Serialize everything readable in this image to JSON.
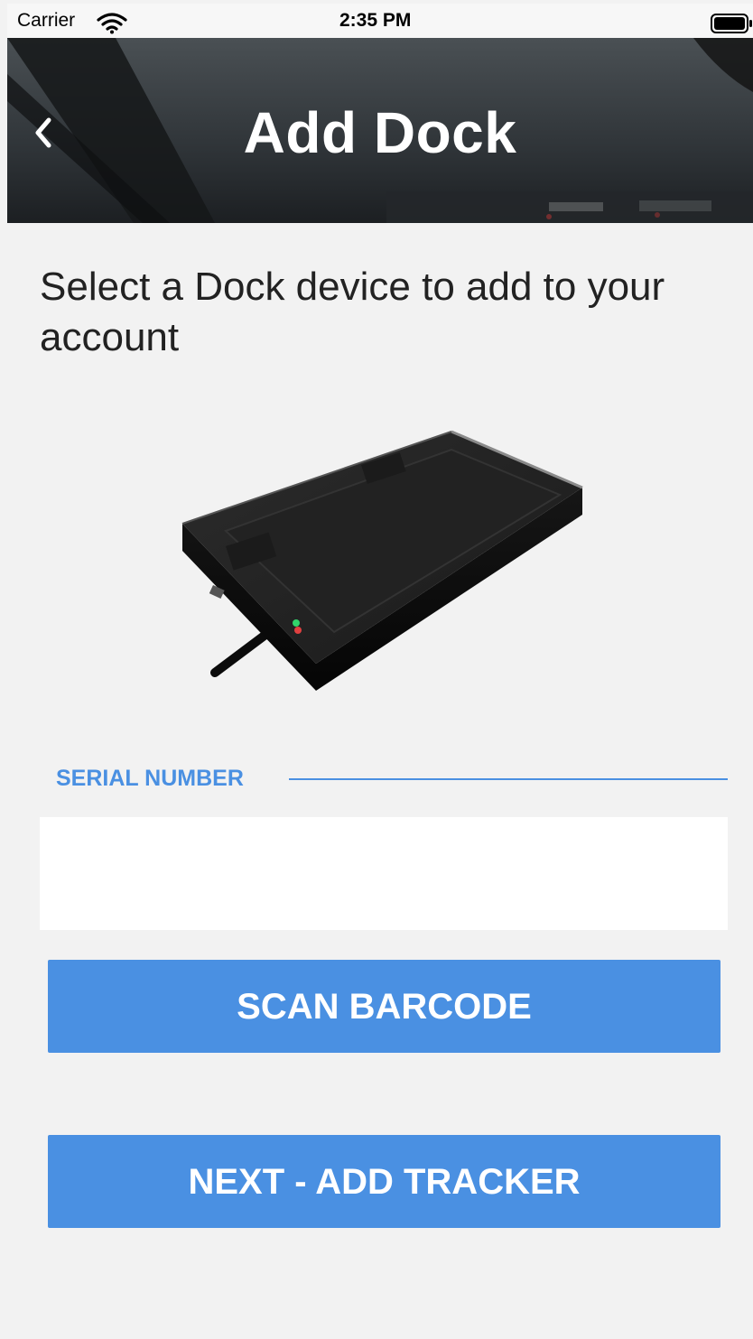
{
  "status_bar": {
    "carrier": "Carrier",
    "time": "2:35 PM"
  },
  "header": {
    "title": "Add Dock",
    "back_icon": "chevron-left-icon"
  },
  "prompt": "Select a Dock device to add to your account",
  "device_image": "dock-device-image",
  "serial": {
    "label": "SERIAL NUMBER",
    "value": "",
    "placeholder": ""
  },
  "buttons": {
    "scan": "SCAN BARCODE",
    "next": "NEXT - ADD TRACKER"
  },
  "colors": {
    "accent": "#4a90e2",
    "background": "#f2f2f2"
  }
}
